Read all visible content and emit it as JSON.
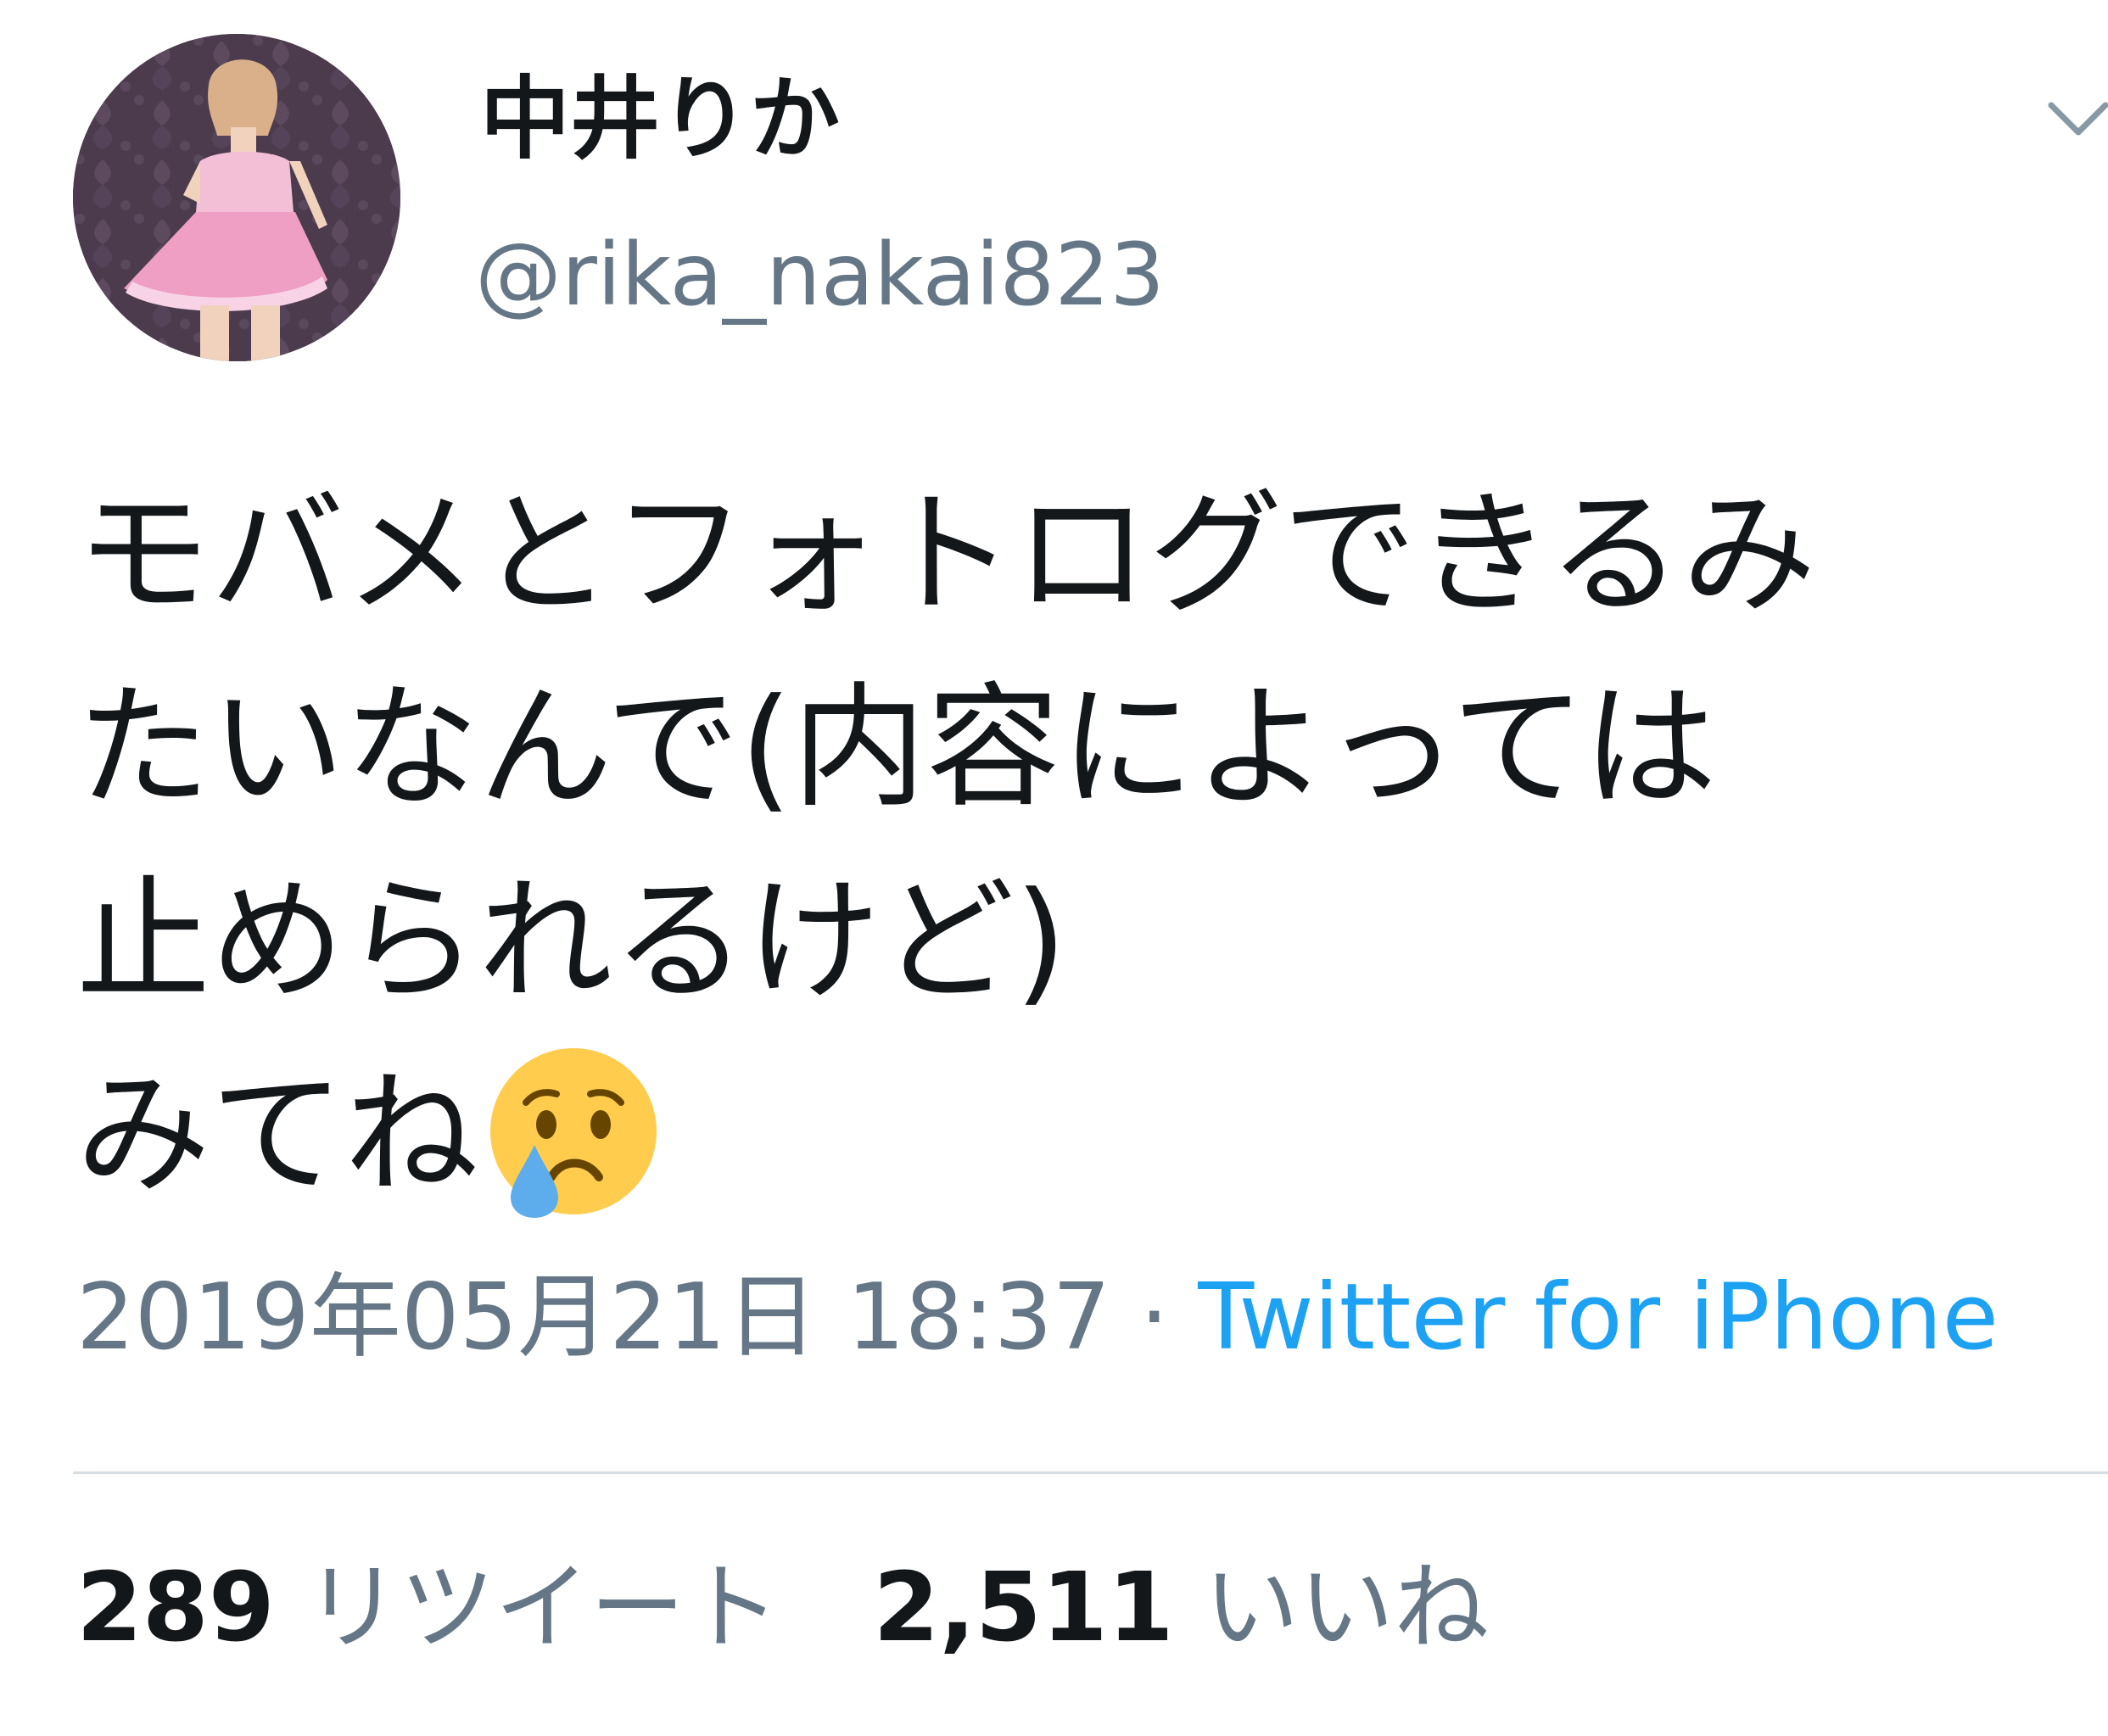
{
  "user": {
    "display_name": "中井りか",
    "handle": "@rika_nakai823"
  },
  "tweet": {
    "lines": [
      "モバメとフォトログできるみ",
      "たいなんで(内容によっては",
      "止められるけど)",
      "みてね"
    ],
    "emoji": "crying-face-emoji"
  },
  "meta": {
    "timestamp": "2019年05月21日 18:37",
    "separator": " · ",
    "source": "Twitter for iPhone"
  },
  "stats": {
    "retweets_count": "289",
    "retweets_label": "リツイート",
    "likes_count": "2,511",
    "likes_label": "いいね"
  },
  "colors": {
    "text": "#14171a",
    "secondary": "#657786",
    "link": "#1da1f2",
    "divider": "#d6dde3"
  }
}
